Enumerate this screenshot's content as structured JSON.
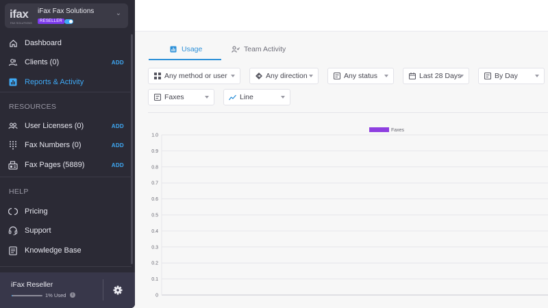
{
  "org": {
    "logo": "ifax",
    "logo_sub": "FAX SOLUTIONS",
    "name": "iFax Fax Solutions",
    "badge": "RESELLER"
  },
  "nav": {
    "dashboard": "Dashboard",
    "clients": "Clients (0)",
    "clients_add": "ADD",
    "reports": "Reports & Activity"
  },
  "resources": {
    "title": "RESOURCES",
    "user_licenses": "User Licenses (0)",
    "user_licenses_add": "ADD",
    "fax_numbers": "Fax Numbers (0)",
    "fax_numbers_add": "ADD",
    "fax_pages": "Fax Pages (5889)",
    "fax_pages_add": "ADD"
  },
  "help": {
    "title": "HELP",
    "pricing": "Pricing",
    "support": "Support",
    "knowledge_base": "Knowledge Base"
  },
  "footer": {
    "name": "iFax Reseller",
    "used": "1% Used",
    "usage_fraction": 0.01,
    "info": "i"
  },
  "tabs": {
    "usage": "Usage",
    "team_activity": "Team Activity"
  },
  "filters": {
    "method": "Any method or user",
    "direction": "Any direction",
    "status": "Any status",
    "range": "Last 28 Days",
    "group": "By Day",
    "type": "Faxes",
    "chart": "Line"
  },
  "colors": {
    "accent": "#2b8fd8",
    "sidebar": "#2b2a35",
    "series": "#8e3fe0",
    "add": "#3fa9f5"
  },
  "chart_data": {
    "type": "line",
    "legend": "top-center",
    "series": [
      {
        "name": "Faxes",
        "values": []
      }
    ],
    "y_ticks": [
      "1.0",
      "0.9",
      "0.8",
      "0.7",
      "0.6",
      "0.5",
      "0.4",
      "0.3",
      "0.2",
      "0.1",
      "0"
    ],
    "ylim": [
      0,
      1
    ],
    "grid": true
  }
}
